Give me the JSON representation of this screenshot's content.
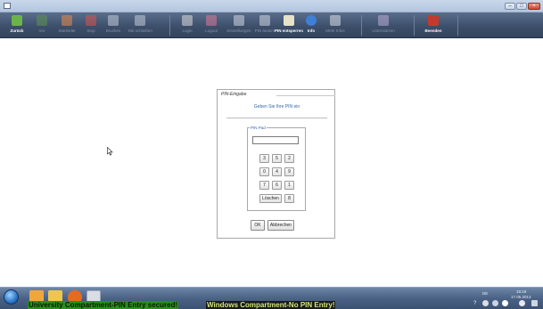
{
  "toolbar": {
    "items": [
      {
        "label": "Zurück",
        "icon": "back-arrow-icon",
        "color": "#6cb44a",
        "enabled": true
      },
      {
        "label": "Vor",
        "icon": "forward-arrow-icon",
        "color": "#5f8f4f",
        "enabled": false
      },
      {
        "label": "Startseite",
        "icon": "home-icon",
        "color": "#e58a4a",
        "enabled": false
      },
      {
        "label": "Stop",
        "icon": "stop-icon",
        "color": "#d9534f",
        "enabled": false
      },
      {
        "label": "Drucken",
        "icon": "printer-icon",
        "color": "#c3cad6",
        "enabled": false
      },
      {
        "label": "Tab schließen",
        "icon": "close-tab-icon",
        "color": "#c3cad6",
        "enabled": false
      },
      {
        "label": "Login",
        "icon": "login-icon",
        "color": "#dcdcdc",
        "enabled": false
      },
      {
        "label": "Logout",
        "icon": "logout-icon",
        "color": "#d97a9a",
        "enabled": false
      },
      {
        "label": "Einstellungen",
        "icon": "tools-icon",
        "color": "#d0d6e0",
        "enabled": false
      },
      {
        "label": "PIN ändern",
        "icon": "pin-change-icon",
        "color": "#d0d6e0",
        "enabled": false
      },
      {
        "label": "PIN entsperren",
        "icon": "pin-unlock-icon",
        "color": "#e8e3c8",
        "enabled": true
      },
      {
        "label": "Info",
        "icon": "info-icon",
        "color": "#3f7fd6",
        "enabled": true
      },
      {
        "label": "Mehr Infos",
        "icon": "folder-icon",
        "color": "#d9dee8",
        "enabled": false
      },
      {
        "label": "Unterstützen",
        "icon": "support-icon",
        "color": "#b9a9d6",
        "enabled": false
      },
      {
        "label": "Beenden",
        "icon": "exit-door-icon",
        "color": "#c23b2e",
        "enabled": true
      }
    ]
  },
  "dialog": {
    "title": "PIN-Eingabe",
    "prompt": "Geben Sie Ihre PIN ein",
    "pinpad_label": "PIN Pad",
    "pin_value": "",
    "keys": [
      [
        "3",
        "5",
        "2"
      ],
      [
        "0",
        "4",
        "9"
      ],
      [
        "7",
        "6",
        "1"
      ]
    ],
    "clear_label": "Löschen",
    "last_key": "8",
    "ok_label": "OK",
    "cancel_label": "Abbrechen"
  },
  "taskbar": {
    "apps": [
      {
        "icon": "media-player-icon",
        "color": "#f2a63a"
      },
      {
        "icon": "explorer-folder-icon",
        "color": "#f0c64a"
      },
      {
        "icon": "firefox-icon",
        "color": "#e86a1e"
      },
      {
        "icon": "window-app-icon",
        "color": "#d9dde5"
      }
    ],
    "tray_lang": "DE",
    "time": "16:19",
    "date": "17.05.2013",
    "help_mark": "?"
  },
  "banner": {
    "green_text": "University Compartment-PIN Entry secured!",
    "black_text": "Windows Compartment-No PIN Entry!"
  },
  "colors": {
    "banner_green": "#2a8f1c",
    "banner_black": "#1a1a1a",
    "prompt_blue": "#3367a8"
  }
}
